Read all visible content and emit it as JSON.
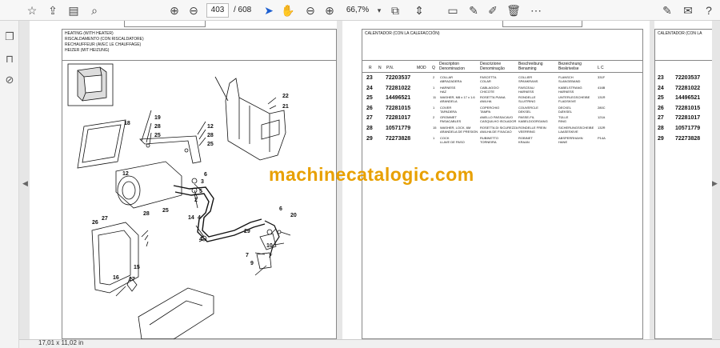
{
  "toolbar": {
    "page_current": "403",
    "page_total": "/ 608",
    "zoom": "66,7%",
    "icons": [
      "star-icon",
      "upload-icon",
      "print-icon",
      "search-zoom-icon",
      "page-up-icon",
      "page-down-icon",
      "pointer-icon",
      "hand-icon",
      "zoom-out-icon",
      "zoom-in-icon",
      "zoom-dropdown-icon",
      "fit-page-icon",
      "scroll-icon",
      "comment-icon",
      "pen-icon",
      "highlight-icon",
      "delete-icon",
      "more-icon",
      "link-edit-icon",
      "email-icon",
      "help-icon"
    ]
  },
  "sidebar": {
    "icons": [
      "pages-icon",
      "bookmark-icon",
      "attachment-icon"
    ]
  },
  "status": {
    "dimensions": "17,01 x 11,02 in"
  },
  "left_page": {
    "title_lines": [
      "HEATING (WITH HEATER)",
      "RISCALDAMENTO (CON RISCALDATORE)",
      "RECHAUFFEUR (AVEC LE CHAUFFAGE)",
      "HEIZER (MIT HEIZUNG)"
    ],
    "callouts": [
      "19",
      "28",
      "25",
      "18",
      "22",
      "21",
      "12",
      "28",
      "25",
      "6",
      "3",
      "5",
      "2",
      "12",
      "14",
      "4",
      "4",
      "27",
      "28",
      "25",
      "26",
      "29",
      "6",
      "20",
      "7",
      "9",
      "10",
      "15",
      "16",
      "17"
    ]
  },
  "middle_page": {
    "title": "CALENTADOR (CON LA CALEFACCIÓN)",
    "headers": {
      "r": "R",
      "n": "N",
      "pn": "P.N.",
      "mod": "MOD",
      "q": "Q",
      "desc": [
        "Description",
        "Denominacion"
      ],
      "descr2": [
        "Descrizione",
        "Denominação"
      ],
      "beschreibung": [
        "Beschreibung",
        "Benaming"
      ],
      "bez": [
        "Bezeichnung",
        "Beskrivelse"
      ],
      "lc": "L C"
    },
    "rows": [
      {
        "r": "23",
        "pn": "72203537",
        "q": "2",
        "c1": [
          "COLLAR",
          "ABRAZADERA"
        ],
        "c2": [
          "FASCETTA",
          "COLAR"
        ],
        "c3": [
          "COLLIER",
          "SPANKRANS"
        ],
        "c4": [
          "FLANSCH",
          "SLANGEBAND"
        ],
        "lc": "331F"
      },
      {
        "r": "24",
        "pn": "72281022",
        "q": "1",
        "c1": [
          "HARNESS",
          "HAZ"
        ],
        "c2": [
          "CABLAGGIO",
          "CHICOTE"
        ],
        "c3": [
          "FAISCEAU",
          "HARNESS"
        ],
        "c4": [
          "KABELSTRANG",
          "HARNESS"
        ],
        "lc": "416B"
      },
      {
        "r": "25",
        "pn": "14496521",
        "q": "11",
        "c1": [
          "WASHER, M8 x 17 x 1.6",
          "ARANDELA"
        ],
        "c2": [
          "ROSETTA PIANA",
          "ANILHA"
        ],
        "c3": [
          "RONDELLE",
          "SLUITRING"
        ],
        "c4": [
          "UNTERLEGSCHEIBE",
          "FLADSKIVE"
        ],
        "lc": "131R"
      },
      {
        "r": "26",
        "pn": "72281015",
        "q": "1",
        "c1": [
          "COVER",
          "TAPADERA"
        ],
        "c2": [
          "COPERCHIO",
          "TAMPA"
        ],
        "c3": [
          "COUVERCLE",
          "DEKSEL"
        ],
        "c4": [
          "DECKEL",
          "DÆKSEL"
        ],
        "lc": "280C"
      },
      {
        "r": "27",
        "pn": "72281017",
        "q": "2",
        "c1": [
          "GROMMET",
          "PASACABLES"
        ],
        "c2": [
          "ANELLO PASSACAVO",
          "CASQUILHO ISOLADOR"
        ],
        "c3": [
          "PASSE-FIL",
          "KABELDOORGANG"
        ],
        "c4": [
          "TÜLLE",
          "RING"
        ],
        "lc": "121A"
      },
      {
        "r": "28",
        "pn": "10571779",
        "q": "15",
        "c1": [
          "WASHER, LOCK, 6M",
          "ARANDELA DE PRESION"
        ],
        "c2": [
          "ROSETTA DI SICUREZZA",
          "ANILHA DE FIXACAO"
        ],
        "c3": [
          "RONDELLE FREIN",
          "VEERRING"
        ],
        "c4": [
          "SICHERUNGSSCHEIBE",
          "LAASESKIVE"
        ],
        "lc": "132R"
      },
      {
        "r": "29",
        "pn": "72273828",
        "q": "1",
        "c1": [
          "COCK",
          "LLAVE DE PASO"
        ],
        "c2": [
          "RUBINETTO",
          "TORNEIRA"
        ],
        "c3": [
          "ROBINET",
          "KRAAN"
        ],
        "c4": [
          "ABSPERRHAHN",
          "HANE"
        ],
        "lc": "P14A"
      }
    ]
  },
  "right_page": {
    "title": "CALENTADOR (CON LA",
    "rows": [
      {
        "r": "23",
        "pn": "72203537"
      },
      {
        "r": "24",
        "pn": "72281022"
      },
      {
        "r": "25",
        "pn": "14496521"
      },
      {
        "r": "26",
        "pn": "72281015"
      },
      {
        "r": "27",
        "pn": "72281017"
      },
      {
        "r": "28",
        "pn": "10571779"
      },
      {
        "r": "29",
        "pn": "72273828"
      }
    ]
  },
  "watermark": "machinecatalogic.com"
}
